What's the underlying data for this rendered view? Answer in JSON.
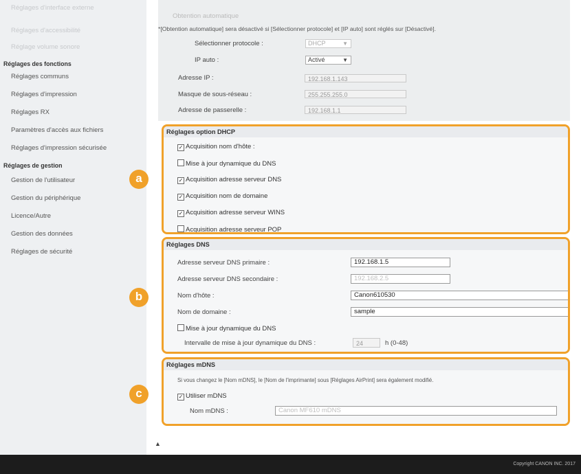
{
  "sidebar": {
    "items": [
      {
        "label": "Réglages d'interface externe",
        "faded": true
      },
      {
        "label": "Réglages d'accessibilité",
        "faded": true
      },
      {
        "label": "Réglage volume sonore",
        "faded": true
      },
      {
        "label": "Réglages des fonctions",
        "heading": true
      },
      {
        "label": "Réglages communs"
      },
      {
        "label": "Réglages d'impression"
      },
      {
        "label": "Réglages RX"
      },
      {
        "label": "Paramètres d'accès aux fichiers"
      },
      {
        "label": "Réglages d'impression sécurisée"
      },
      {
        "label": "Réglages de gestion",
        "heading": true
      },
      {
        "label": "Gestion de l'utilisateur"
      },
      {
        "label": "Gestion du périphérique"
      },
      {
        "label": "Licence/Autre"
      },
      {
        "label": "Gestion des données"
      },
      {
        "label": "Réglages de sécurité"
      }
    ]
  },
  "top": {
    "auto_label": "Obtention automatique",
    "note": "*[Obtention automatique] sera désactivé si [Sélectionner protocole] et [IP auto] sont réglés sur [Désactivé].",
    "protocol_label": "Sélectionner protocole :",
    "protocol_value": "DHCP",
    "ipauto_label": "IP auto :",
    "ipauto_value": "Activé",
    "ip_label": "Adresse IP :",
    "ip_value": "192.168.1.143",
    "mask_label": "Masque de sous-réseau :",
    "mask_value": "255.255.255.0",
    "gateway_label": "Adresse de passerelle :",
    "gateway_value": "192.168.1.1"
  },
  "dhcp": {
    "title": "Réglages option DHCP",
    "options": [
      {
        "label": "Acquisition nom d'hôte :",
        "checked": true
      },
      {
        "label": "Mise à jour dynamique du DNS",
        "checked": false
      },
      {
        "label": "Acquisition adresse serveur DNS",
        "checked": true
      },
      {
        "label": "Acquisition nom de domaine",
        "checked": true
      },
      {
        "label": "Acquisition adresse serveur WINS",
        "checked": true
      },
      {
        "label": "Acquisition adresse serveur POP",
        "checked": false
      }
    ]
  },
  "dns": {
    "title": "Réglages DNS",
    "primary_label": "Adresse serveur DNS primaire :",
    "primary_value": "192.168.1.5",
    "secondary_label": "Adresse serveur DNS secondaire :",
    "secondary_value": "192.168.2.5",
    "host_label": "Nom d'hôte :",
    "host_value": "Canon610530",
    "domain_label": "Nom de domaine :",
    "domain_value": "sample",
    "dyn_label": "Mise à jour dynamique du DNS",
    "dyn_checked": false,
    "interval_label": "Intervalle de mise à jour dynamique du DNS :",
    "interval_value": "24",
    "interval_unit": "h (0-48)"
  },
  "mdns": {
    "title": "Réglages mDNS",
    "note": "Si vous changez le [Nom mDNS], le [Nom de l'imprimante] sous [Réglages AirPrint] sera également modifié.",
    "use_label": "Utiliser mDNS",
    "use_checked": true,
    "name_label": "Nom mDNS :",
    "name_value": "Canon MF610 mDNS"
  },
  "badges": [
    "a",
    "b",
    "c"
  ],
  "to_top": "▲",
  "copyright": "Copyright CANON INC. 2017",
  "colors": {
    "accent": "#f0a12a",
    "footer": "#1c1c1c",
    "sidebar": "#eef0f2"
  }
}
